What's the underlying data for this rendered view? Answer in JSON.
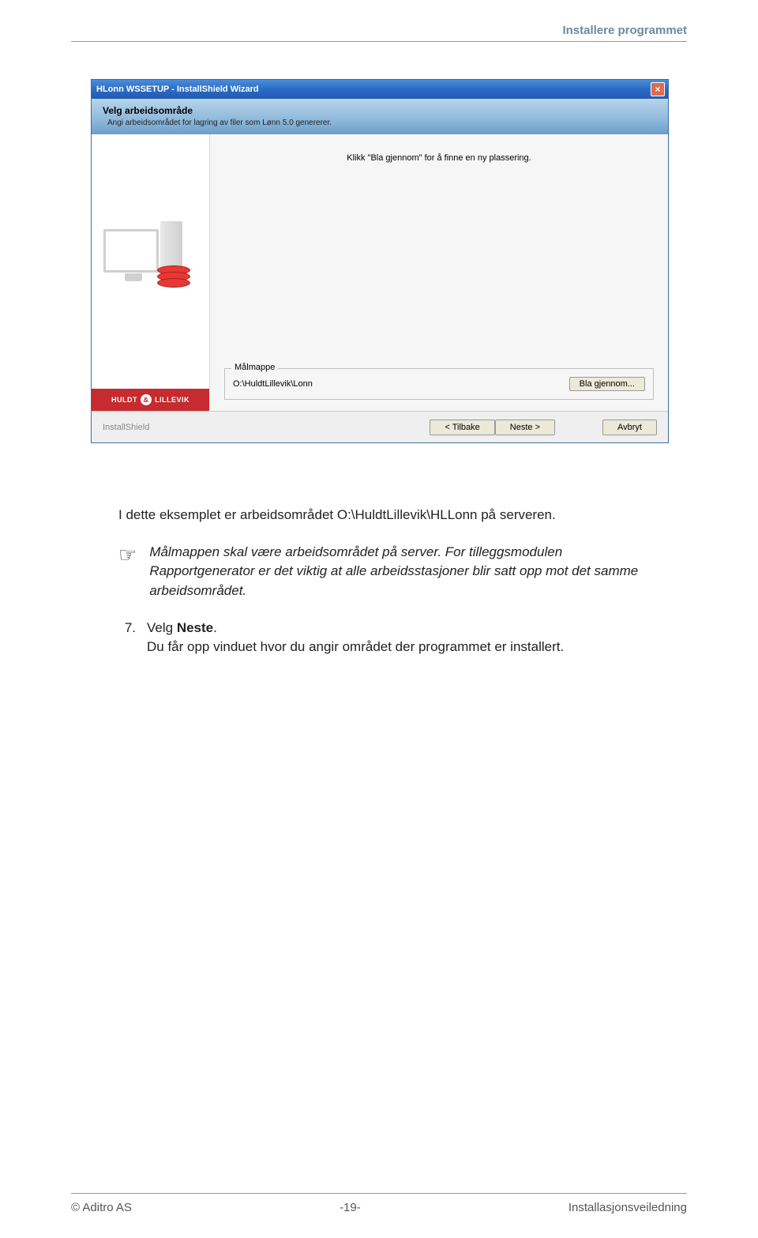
{
  "header": {
    "section_title": "Installere programmet"
  },
  "wizard": {
    "title": "HLonn WSSETUP - InstallShield Wizard",
    "close_label": "×",
    "step_title": "Velg arbeidsområde",
    "step_desc": "Angi arbeidsområdet for lagring av filer som Lønn 5.0 genererer.",
    "center_hint": "Klikk \"Bla gjennom\" for å finne en ny plassering.",
    "target_legend": "Målmappe",
    "target_path": "O:\\HuldtLillevik\\Lonn",
    "browse_label": "Bla gjennom...",
    "brand": {
      "left": "HULDT",
      "amp": "&",
      "right": "LILLEVIK"
    },
    "ishield_label": "InstallShield",
    "buttons": {
      "back": "< Tilbake",
      "next": "Neste >",
      "cancel": "Avbryt"
    }
  },
  "body": {
    "intro": "I dette eksemplet er arbeidsområdet O:\\HuldtLillevik\\HLLonn på serveren.",
    "note_icon": "☞",
    "note": "Målmappen skal være arbeidsområdet på server. For tilleggsmodulen Rapportgenerator er det viktig at alle arbeidsstasjoner blir satt opp mot det samme arbeidsområdet.",
    "step_num": "7.",
    "step_prefix": "Velg ",
    "step_bold": "Neste",
    "step_rest": ".\nDu får opp vinduet hvor du angir området der programmet er installert."
  },
  "footer": {
    "left": "© Aditro AS",
    "center": "-19-",
    "right": "Installasjonsveiledning"
  }
}
